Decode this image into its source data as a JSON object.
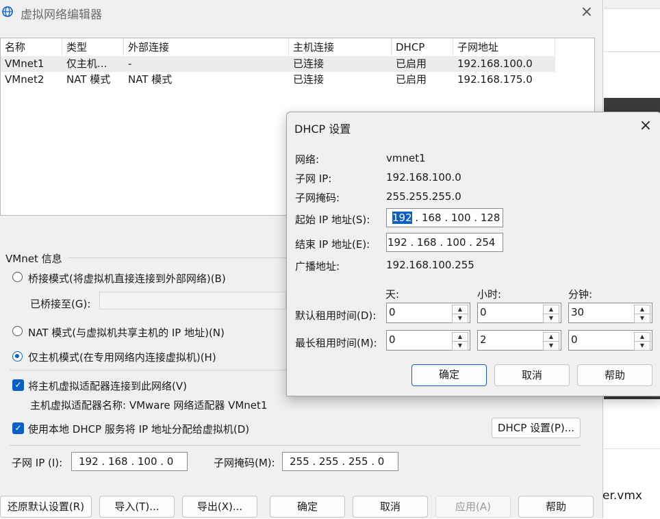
{
  "main_window": {
    "title": "虚拟网络编辑器",
    "close_glyph": "×",
    "columns": [
      "名称",
      "类型",
      "外部连接",
      "主机连接",
      "DHCP",
      "子网地址"
    ],
    "rows": [
      [
        "VMnet1",
        "仅主机...",
        "-",
        "已连接",
        "已启用",
        "192.168.100.0"
      ],
      [
        "VMnet2",
        "NAT 模式",
        "NAT 模式",
        "已连接",
        "已启用",
        "192.168.175.0"
      ]
    ],
    "vmnet_info_label": "VMnet 信息",
    "bridge_mode": "桥接模式(将虚拟机直接连接到外部网络)(B)",
    "bridged_to_label": "已桥接至(G):",
    "bridged_to_value": "",
    "nat_mode": "NAT 模式(与虚拟机共享主机的 IP 地址)(N)",
    "host_only_mode": "仅主机模式(在专用网络内连接虚拟机)(H)",
    "selected_mode": "host_only",
    "connect_adapter": "将主机虚拟适配器连接到此网络(V)",
    "adapter_name": "主机虚拟适配器名称: VMware 网络适配器 VMnet1",
    "use_dhcp": "使用本地 DHCP 服务将 IP 地址分配给虚拟机(D)",
    "dhcp_settings_button": "DHCP 设置(P)...",
    "subnet_ip_label": "子网 IP (I):",
    "subnet_ip_value": "192 . 168 . 100 .  0",
    "subnet_mask_label": "子网掩码(M):",
    "subnet_mask_value": "255 . 255 . 255 .  0",
    "buttons": {
      "restore": "还原默认设置(R)",
      "import": "导入(T)...",
      "export": "导出(X)...",
      "ok": "确定",
      "cancel": "取消",
      "apply": "应用(A)",
      "help": "帮助"
    }
  },
  "dhcp_dialog": {
    "title": "DHCP 设置",
    "close_glyph": "×",
    "network_label": "网络:",
    "network_value": "vmnet1",
    "subnet_ip_label": "子网 IP:",
    "subnet_ip_value": "192.168.100.0",
    "subnet_mask_label": "子网掩码:",
    "subnet_mask_value": "255.255.255.0",
    "start_ip_label": "起始 IP 地址(S):",
    "start_ip_first": "192",
    "start_ip_rest": " . 168 . 100 . 128",
    "end_ip_label": "结束 IP 地址(E):",
    "end_ip_value": " 192 . 168 . 100 . 254",
    "broadcast_label": "广播地址:",
    "broadcast_value": "192.168.100.255",
    "days_label": "天:",
    "hours_label": "小时:",
    "minutes_label": "分钟:",
    "default_lease_label": "默认租用时间(D):",
    "default_lease": {
      "days": "0",
      "hours": "0",
      "minutes": "30"
    },
    "max_lease_label": "最长租用时间(M):",
    "max_lease": {
      "days": "0",
      "hours": "2",
      "minutes": "0"
    },
    "buttons": {
      "ok": "确定",
      "cancel": "取消",
      "help": "帮助"
    }
  },
  "background": {
    "file_suffix": "er.vmx"
  },
  "colors": {
    "accent": "#0a5fc4",
    "window_bg": "#f0f0f0",
    "selected_row": "#ececec"
  }
}
